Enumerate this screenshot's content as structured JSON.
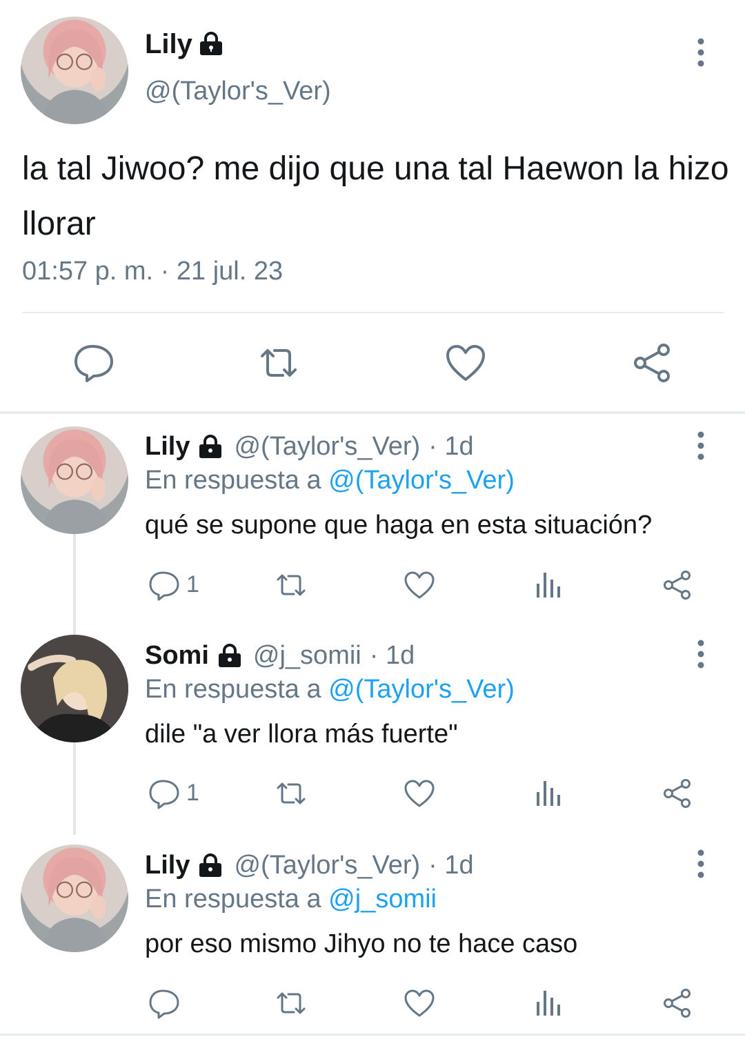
{
  "main_tweet": {
    "name": "Lily",
    "handle": "@(Taylor's_Ver)",
    "text": "la tal Jiwoo? me dijo que una tal Haewon la hizo llorar",
    "timestamp": "01:57 p. m. · 21 jul. 23",
    "icons": {
      "lock": "lock-icon",
      "more": "more-vertical-icon",
      "reply": "reply-icon",
      "retweet": "retweet-icon",
      "like": "heart-icon",
      "share": "share-icon"
    }
  },
  "replies": [
    {
      "name": "Lily",
      "handle": "@(Taylor's_Ver)",
      "age": "· 1d",
      "reply_prefix": "En respuesta a ",
      "reply_to": "@(Taylor's_Ver)",
      "text": "qué se supone que haga en esta situación?",
      "reply_count": "1"
    },
    {
      "name": "Somi",
      "handle": "@j_somii",
      "age": "· 1d",
      "reply_prefix": "En respuesta a ",
      "reply_to": "@(Taylor's_Ver)",
      "text": "dile \"a ver llora más fuerte\"",
      "reply_count": "1"
    },
    {
      "name": "Lily",
      "handle": "@(Taylor's_Ver)",
      "age": "· 1d",
      "reply_prefix": "En respuesta a ",
      "reply_to": "@j_somii",
      "text": "por eso mismo Jihyo no te hace caso",
      "reply_count": ""
    }
  ],
  "colors": {
    "text": "#14171a",
    "secondary": "#657786",
    "link": "#1da1f2",
    "divider": "#e6ecf0"
  }
}
